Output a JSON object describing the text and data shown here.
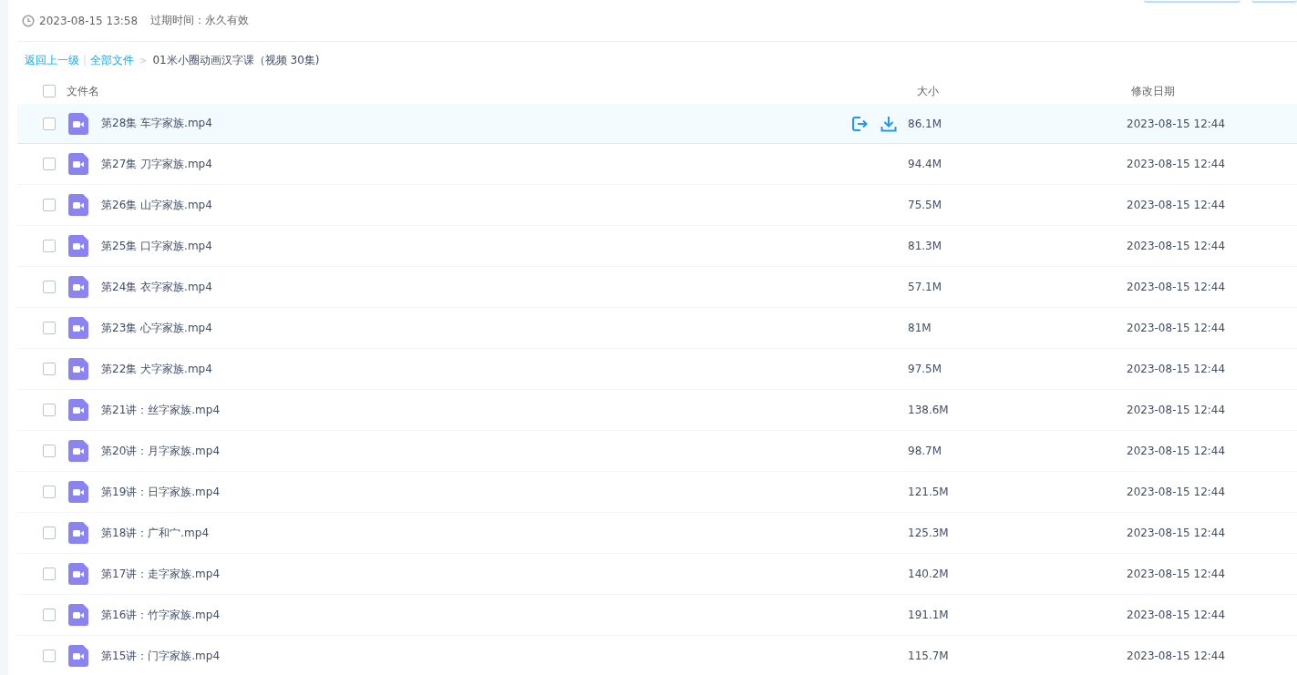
{
  "info": {
    "created": "2023-08-15 13:58",
    "expiry_label": "过期时间：",
    "expiry_value": "永久有效"
  },
  "top_buttons": [
    {
      "kind": "wide"
    },
    {
      "kind": "narrow"
    }
  ],
  "breadcrumb": {
    "back": "返回上一级",
    "separator": "|",
    "root": "全部文件",
    "arrow": ">",
    "current": "01米小圈动画汉字课（视频 30集)"
  },
  "table": {
    "select_all": false,
    "columns": [
      "文件名",
      "大小",
      "修改日期"
    ],
    "rows": [
      {
        "name": "第28集 车字家族.mp4",
        "size": "86.1M",
        "date": "2023-08-15 12:44",
        "checked": false,
        "hovered": true
      },
      {
        "name": "第27集 刀字家族.mp4",
        "size": "94.4M",
        "date": "2023-08-15 12:44",
        "checked": false,
        "hovered": false
      },
      {
        "name": "第26集 山字家族.mp4",
        "size": "75.5M",
        "date": "2023-08-15 12:44",
        "checked": false,
        "hovered": false
      },
      {
        "name": "第25集 口字家族.mp4",
        "size": "81.3M",
        "date": "2023-08-15 12:44",
        "checked": false,
        "hovered": false
      },
      {
        "name": "第24集 衣字家族.mp4",
        "size": "57.1M",
        "date": "2023-08-15 12:44",
        "checked": false,
        "hovered": false
      },
      {
        "name": "第23集 心字家族.mp4",
        "size": "81M",
        "date": "2023-08-15 12:44",
        "checked": false,
        "hovered": false
      },
      {
        "name": "第22集 犬字家族.mp4",
        "size": "97.5M",
        "date": "2023-08-15 12:44",
        "checked": false,
        "hovered": false
      },
      {
        "name": "第21讲：丝字家族.mp4",
        "size": "138.6M",
        "date": "2023-08-15 12:44",
        "checked": false,
        "hovered": false
      },
      {
        "name": "第20讲：月字家族.mp4",
        "size": "98.7M",
        "date": "2023-08-15 12:44",
        "checked": false,
        "hovered": false
      },
      {
        "name": "第19讲：日字家族.mp4",
        "size": "121.5M",
        "date": "2023-08-15 12:44",
        "checked": false,
        "hovered": false
      },
      {
        "name": "第18讲：广和宀.mp4",
        "size": "125.3M",
        "date": "2023-08-15 12:44",
        "checked": false,
        "hovered": false
      },
      {
        "name": "第17讲：走字家族.mp4",
        "size": "140.2M",
        "date": "2023-08-15 12:44",
        "checked": false,
        "hovered": false
      },
      {
        "name": "第16讲：竹字家族.mp4",
        "size": "191.1M",
        "date": "2023-08-15 12:44",
        "checked": false,
        "hovered": false
      },
      {
        "name": "第15讲：门字家族.mp4",
        "size": "115.7M",
        "date": "2023-08-15 12:44",
        "checked": false,
        "hovered": false
      }
    ]
  }
}
